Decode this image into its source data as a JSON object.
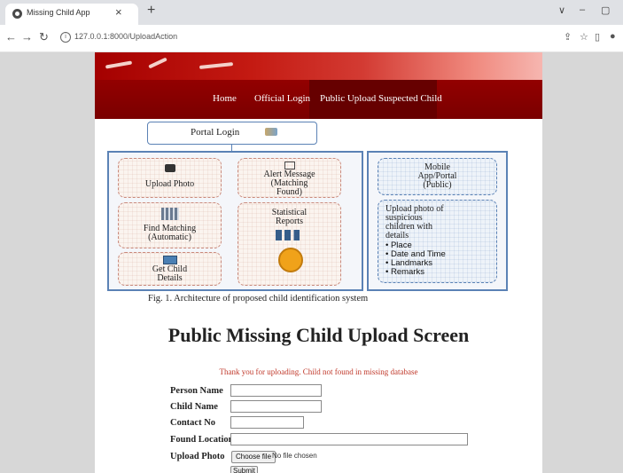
{
  "browser": {
    "tab_title": "Missing Child App",
    "tab_close": "×",
    "new_tab": "+",
    "url": "127.0.0.1:8000/UploadAction",
    "window_controls": [
      "∨",
      "–",
      "▢"
    ]
  },
  "nav": {
    "home": "Home",
    "official_login": "Official Login",
    "public_upload": "Public Upload Suspected Child"
  },
  "diagram": {
    "portal_login": "Portal Login",
    "upload_photo": "Upload Photo",
    "alert_message": [
      "Alert Message",
      "(Matching",
      "Found)"
    ],
    "find_matching": [
      "Find Matching",
      "(Automatic)"
    ],
    "statistical_reports": [
      "Statistical",
      "Reports"
    ],
    "get_child_details": [
      "Get Child",
      "Details"
    ],
    "mobile_app": [
      "Mobile",
      "App/Portal",
      "(Public)"
    ],
    "upload_suspicious": [
      "Upload photo of",
      "suspicious",
      "children with",
      "details"
    ],
    "details_list": [
      "Place",
      "Date and Time",
      "Landmarks",
      "Remarks"
    ],
    "caption": "Fig. 1.   Architecture of proposed child identification system"
  },
  "form": {
    "heading": "Public Missing Child Upload Screen",
    "message": "Thank you for uploading. Child not found in missing database",
    "person_name_label": "Person Name",
    "child_name_label": "Child Name",
    "contact_no_label": "Contact No",
    "found_location_label": "Found Location",
    "upload_photo_label": "Upload Photo",
    "person_name_value": "",
    "child_name_value": "",
    "contact_no_value": "",
    "found_location_value": "",
    "choose_file_label": "Choose file",
    "no_file_text": "No file chosen",
    "submit_label": "Submit"
  },
  "colors": {
    "nav_bg": "#8b0000",
    "message": "#c0392b",
    "diagram_border": "#5b82b5"
  }
}
